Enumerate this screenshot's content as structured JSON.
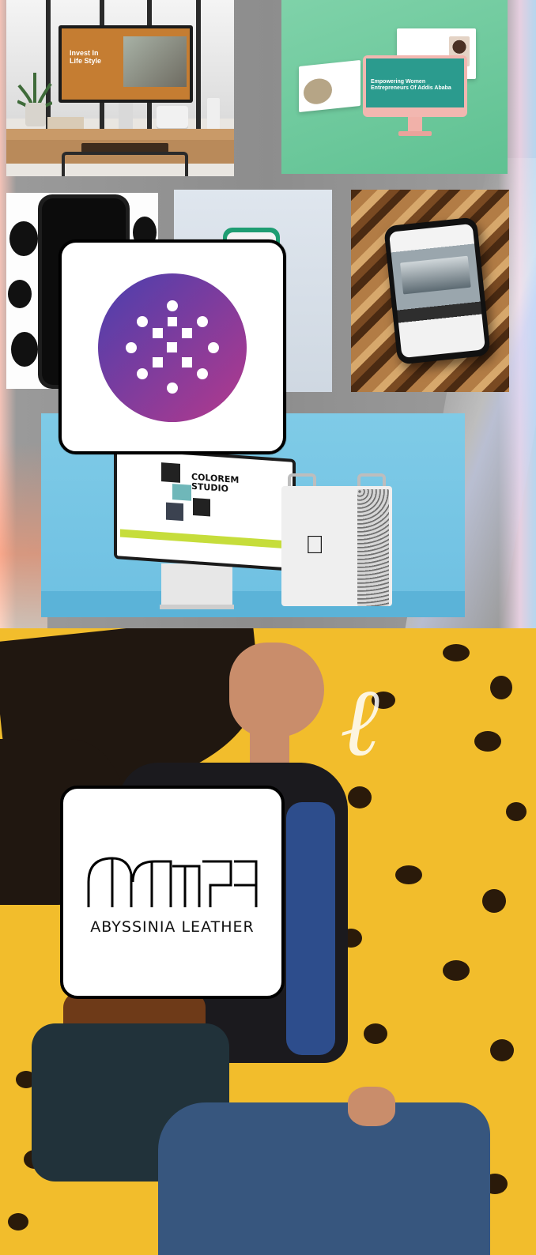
{
  "tiles": {
    "desk": {
      "screen_title": "Invest In\nLife Style"
    },
    "green": {
      "main_heading": "Empowering Women Entrepreneurs Of Addis Ababa"
    },
    "studio": {
      "title": "COLOREM\nSTUDIO"
    }
  },
  "logo_card_2": {
    "brand_name": "ABYSSINIA LEATHER"
  },
  "colors": {
    "purple_logo_start": "#5a3fb0",
    "purple_logo_end": "#b03a8e",
    "yellow_wall": "#f2bd2c"
  }
}
